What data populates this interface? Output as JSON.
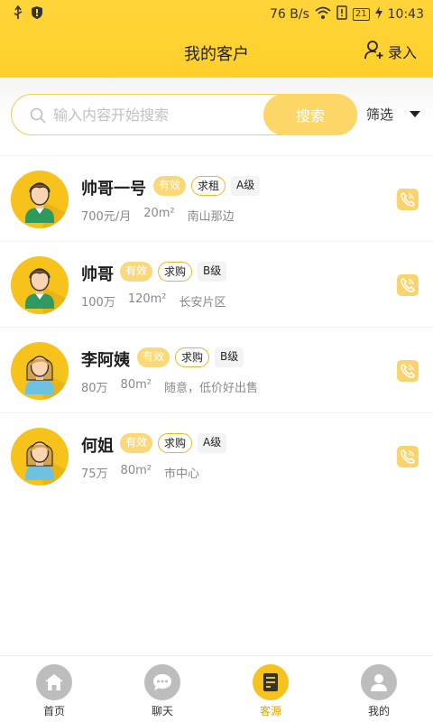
{
  "status": {
    "speed": "76 B/s",
    "battery": "21",
    "time": "10:43"
  },
  "header": {
    "title": "我的客户",
    "record_label": "录入"
  },
  "search": {
    "placeholder": "输入内容开始搜索",
    "button_label": "搜索",
    "filter_label": "筛选"
  },
  "clients": [
    {
      "name": "帅哥一号",
      "valid": "有效",
      "type": "求租",
      "grade": "A级",
      "price": "700元/月",
      "area": "20m²",
      "location": "南山那边",
      "avatar": "male"
    },
    {
      "name": "帅哥",
      "valid": "有效",
      "type": "求购",
      "grade": "B级",
      "price": "100万",
      "area": "120m²",
      "location": "长安片区",
      "avatar": "male"
    },
    {
      "name": "李阿姨",
      "valid": "有效",
      "type": "求购",
      "grade": "B级",
      "price": "80万",
      "area": "80m²",
      "location": "随意，低价好出售",
      "avatar": "female"
    },
    {
      "name": "何姐",
      "valid": "有效",
      "type": "求购",
      "grade": "A级",
      "price": "75万",
      "area": "80m²",
      "location": "市中心",
      "avatar": "female"
    }
  ],
  "nav": [
    {
      "label": "首页",
      "icon": "home-icon",
      "active": false
    },
    {
      "label": "聊天",
      "icon": "chat-icon",
      "active": false
    },
    {
      "label": "客源",
      "icon": "clients-icon",
      "active": true
    },
    {
      "label": "我的",
      "icon": "profile-icon",
      "active": false
    }
  ],
  "colors": {
    "accent": "#ffd43a",
    "tag_valid": "#fad87a",
    "active_nav": "#f6c21d"
  }
}
